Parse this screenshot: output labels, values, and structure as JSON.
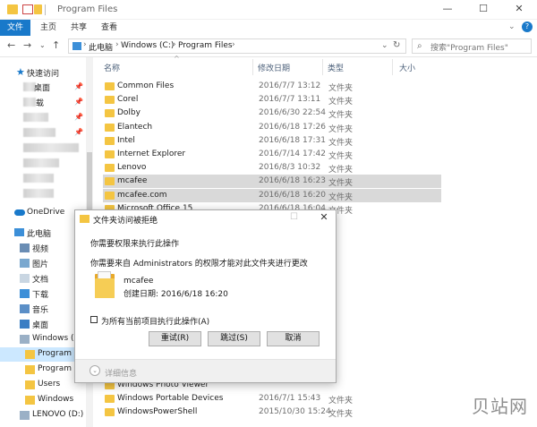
{
  "titlebar": {
    "title": "Program Files",
    "minimize": "—",
    "maximize": "☐",
    "close": "✕"
  },
  "ribbon": {
    "tabs": [
      "文件",
      "主页",
      "共享",
      "查看"
    ]
  },
  "address": {
    "crumbs": [
      "此电脑",
      "Windows (C:)",
      "Program Files"
    ],
    "search_placeholder": "搜索\"Program Files\""
  },
  "nav": {
    "quick_access": "快速访问",
    "quick_items": [
      "桌面",
      "载"
    ],
    "onedrive": "OneDrive",
    "this_pc": "此电脑",
    "pc_items": [
      "视频",
      "图片",
      "文档",
      "下载",
      "音乐",
      "桌面"
    ],
    "windows_drive": "Windows (C:",
    "drive_children": [
      "Program Fil",
      "Program Fil",
      "Users",
      "Windows"
    ],
    "lenovo_drive": "LENOVO (D:)"
  },
  "columns": {
    "name": "名称",
    "date": "修改日期",
    "type": "类型",
    "size": "大小"
  },
  "files": [
    {
      "name": "Common Files",
      "date": "2016/7/7 13:12",
      "type": "文件夹"
    },
    {
      "name": "Corel",
      "date": "2016/7/7 13:11",
      "type": "文件夹"
    },
    {
      "name": "Dolby",
      "date": "2016/6/30 22:54",
      "type": "文件夹"
    },
    {
      "name": "Elantech",
      "date": "2016/6/18 17:26",
      "type": "文件夹"
    },
    {
      "name": "Intel",
      "date": "2016/6/18 17:31",
      "type": "文件夹"
    },
    {
      "name": "Internet Explorer",
      "date": "2016/7/14 17:42",
      "type": "文件夹"
    },
    {
      "name": "Lenovo",
      "date": "2016/8/3 10:32",
      "type": "文件夹"
    },
    {
      "name": "mcafee",
      "date": "2016/6/18 16:23",
      "type": "文件夹"
    },
    {
      "name": "mcafee.com",
      "date": "2016/6/18 16:20",
      "type": "文件夹"
    },
    {
      "name": "Microsoft Office 15",
      "date": "2016/6/18 16:04",
      "type": "文件夹"
    }
  ],
  "files_bottom": [
    {
      "name": "Windows Photo Viewer",
      "date": "",
      "type": ""
    },
    {
      "name": "Windows Portable Devices",
      "date": "2016/7/1 15:43",
      "type": "文件夹"
    },
    {
      "name": "WindowsPowerShell",
      "date": "2015/10/30 15:24",
      "type": "文件夹"
    }
  ],
  "dialog": {
    "title": "文件夹访问被拒绝",
    "line1": "你需要权限来执行此操作",
    "line2": "你需要来自 Administrators 的权限才能对此文件夹进行更改",
    "folder_name": "mcafee",
    "folder_date": "创建日期: 2016/6/18 16:20",
    "checkbox_label": "为所有当前项目执行此操作(A)",
    "retry": "重试(R)",
    "skip": "跳过(S)",
    "cancel": "取消",
    "details": "详细信息"
  },
  "watermark": "贝站网"
}
